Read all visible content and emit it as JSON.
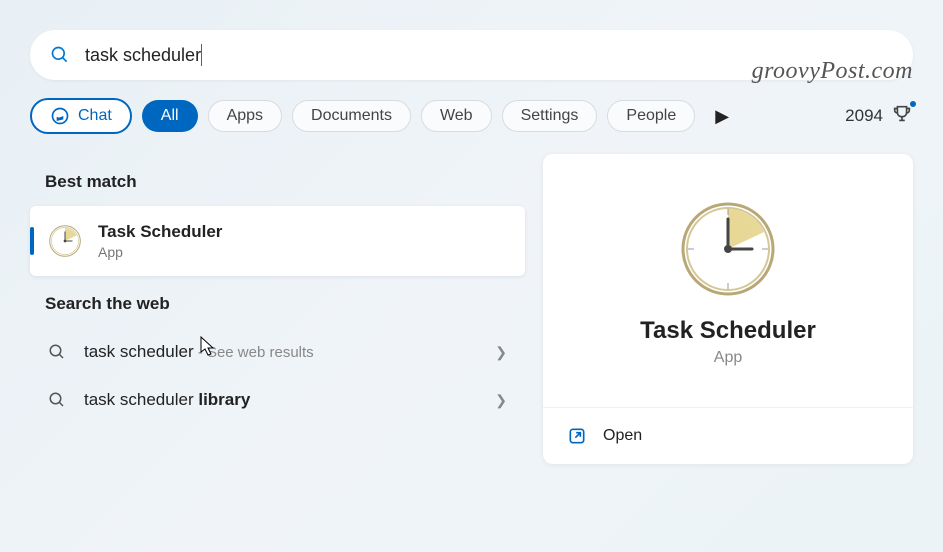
{
  "watermark": "groovyPost.com",
  "search": {
    "value": "task scheduler"
  },
  "filters": {
    "chat": "Chat",
    "all": "All",
    "items": [
      "Apps",
      "Documents",
      "Web",
      "Settings",
      "People"
    ]
  },
  "rewards": {
    "points": "2094"
  },
  "sections": {
    "best_match": "Best match",
    "search_web": "Search the web"
  },
  "best_match_result": {
    "title": "Task Scheduler",
    "subtitle": "App"
  },
  "web_results": [
    {
      "text": "task scheduler",
      "suffix": " - See web results",
      "bold": ""
    },
    {
      "text": "task scheduler ",
      "suffix": "",
      "bold": "library"
    }
  ],
  "details": {
    "title": "Task Scheduler",
    "subtitle": "App",
    "open": "Open"
  }
}
